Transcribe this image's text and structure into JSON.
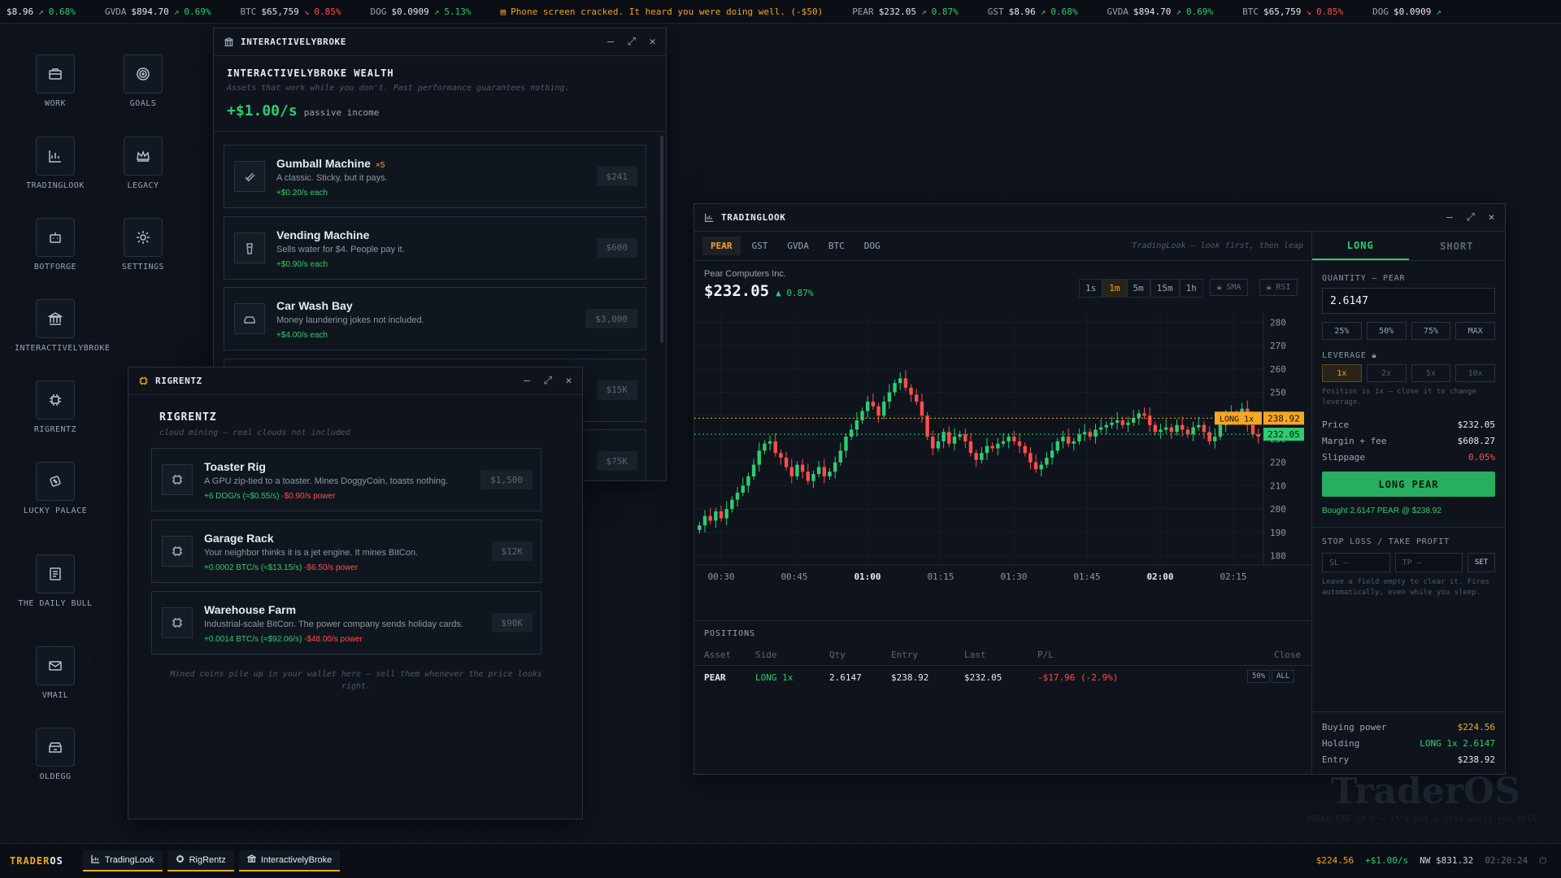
{
  "ticker": [
    {
      "sym": "",
      "price": "$8.96",
      "change": "0.68%",
      "dir": "up"
    },
    {
      "sym": "GVDA",
      "price": "$894.70",
      "change": "0.69%",
      "dir": "up"
    },
    {
      "sym": "BTC",
      "price": "$65,759",
      "change": "0.85%",
      "dir": "down"
    },
    {
      "sym": "DOG",
      "price": "$0.0909",
      "change": "5.13%",
      "dir": "up"
    },
    {
      "news": "Phone screen cracked. It heard you were doing well. (-$50)"
    },
    {
      "sym": "PEAR",
      "price": "$232.05",
      "change": "0.87%",
      "dir": "up"
    },
    {
      "sym": "GST",
      "price": "$8.96",
      "change": "0.68%",
      "dir": "up"
    },
    {
      "sym": "GVDA",
      "price": "$894.70",
      "change": "0.69%",
      "dir": "up"
    },
    {
      "sym": "BTC",
      "price": "$65,759",
      "change": "0.85%",
      "dir": "down"
    },
    {
      "sym": "DOG",
      "price": "$0.0909",
      "change": "",
      "dir": "up"
    }
  ],
  "desktop_icons": [
    {
      "label": "WORK",
      "icon": "briefcase-icon"
    },
    {
      "label": "GOALS",
      "icon": "target-icon"
    },
    {
      "label": "TRADINGLOOK",
      "icon": "chart-icon"
    },
    {
      "label": "LEGACY",
      "icon": "crown-icon"
    },
    {
      "label": "BOTFORGE",
      "icon": "robot-icon"
    },
    {
      "label": "SETTINGS",
      "icon": "gear-icon"
    },
    {
      "label": "INTERACTIVELYBROKE",
      "icon": "bank-icon"
    },
    {
      "label": "RIGRENTZ",
      "icon": "chip-icon"
    },
    {
      "label": "LUCKY PALACE",
      "icon": "dice-icon"
    },
    {
      "label": "THE DAILY BULL",
      "icon": "newspaper-icon"
    },
    {
      "label": "VMAIL",
      "icon": "mail-icon"
    },
    {
      "label": "OLDEGG",
      "icon": "store-icon"
    }
  ],
  "ib": {
    "window_title": "INTERACTIVELYBROKE",
    "title": "INTERACTIVELYBROKE WEALTH",
    "subtitle": "Assets that work while you don't. Past performance guarantees nothing.",
    "income": "+$1.00/s",
    "income_label": "passive income",
    "items": [
      {
        "name": "Gumball Machine",
        "count": "×5",
        "desc": "A classic. Sticky, but it pays.",
        "income": "+$0.20/s each",
        "price": "$241"
      },
      {
        "name": "Vending Machine",
        "count": "",
        "desc": "Sells water for $4. People pay it.",
        "income": "+$0.90/s each",
        "price": "$600"
      },
      {
        "name": "Car Wash Bay",
        "count": "",
        "desc": "Money laundering jokes not included.",
        "income": "+$4.00/s each",
        "price": "$3,000"
      },
      {
        "price": "$15K"
      },
      {
        "price": "$75K"
      }
    ]
  },
  "rr": {
    "window_title": "RIGRENTZ",
    "title": "RIGRENTZ",
    "subtitle": "cloud mining — real clouds not included",
    "items": [
      {
        "name": "Toaster Rig",
        "desc": "A GPU zip-tied to a toaster. Mines DoggyCoin, toasts nothing.",
        "yield": "+6 DOG/s (≈$0.55/s)",
        "power": "-$0.90/s power",
        "price": "$1,500"
      },
      {
        "name": "Garage Rack",
        "desc": "Your neighbor thinks it is a jet engine. It mines BitCon.",
        "yield": "+0.0002 BTC/s (≈$13.15/s)",
        "power": "-$6.50/s power",
        "price": "$12K"
      },
      {
        "name": "Warehouse Farm",
        "desc": "Industrial-scale BitCon. The power company sends holiday cards.",
        "yield": "+0.0014 BTC/s (≈$92.06/s)",
        "power": "-$48.00/s power",
        "price": "$90K"
      }
    ],
    "footer": "Mined coins pile up in your wallet here — sell them whenever the price looks right."
  },
  "tl": {
    "window_title": "TRADINGLOOK",
    "tabs": [
      "PEAR",
      "GST",
      "GVDA",
      "BTC",
      "DOG"
    ],
    "tagline": "TradingLook — look first, then leap",
    "company": "Pear Computers Inc.",
    "price": "$232.05",
    "change": "▲ 0.87%",
    "timeframes": [
      "1s",
      "1m",
      "5m",
      "15m",
      "1h"
    ],
    "indicators": [
      "SMA",
      "RSI"
    ],
    "positions_title": "POSITIONS",
    "pos_headers": [
      "Asset",
      "Side",
      "Qty",
      "Entry",
      "Last",
      "P/L",
      "Close"
    ],
    "position": {
      "asset": "PEAR",
      "side": "LONG 1x",
      "qty": "2.6147",
      "entry": "$238.92",
      "last": "$232.05",
      "pl": "-$17.96 (-2.9%)",
      "btn50": "50%",
      "btnall": "ALL"
    },
    "side_tabs": [
      "LONG",
      "SHORT"
    ],
    "qty_label": "QUANTITY — PEAR",
    "qty_value": "2.6147",
    "pct_buttons": [
      "25%",
      "50%",
      "75%",
      "MAX"
    ],
    "leverage_label": "LEVERAGE",
    "leverage": [
      "1x",
      "2x",
      "5x",
      "10x"
    ],
    "leverage_hint": "Position is 1x — close it to change leverage.",
    "price_label": "Price",
    "price_value": "$232.05",
    "margin_label": "Margin + fee",
    "margin_value": "$608.27",
    "slippage_label": "Slippage",
    "slippage_value": "0.05%",
    "action": "LONG PEAR",
    "confirm": "Bought 2.6147 PEAR @ $238.92",
    "sltp_label": "STOP LOSS / TAKE PROFIT",
    "sl_placeholder": "SL —",
    "tp_placeholder": "TP —",
    "set": "SET",
    "sltp_hint": "Leave a field empty to clear it. Fires automatically, even while you sleep.",
    "buying_power_label": "Buying power",
    "buying_power": "$224.56",
    "holding_label": "Holding",
    "holding": "LONG 1x 2.6147",
    "entry_label": "Entry",
    "entry": "$238.92",
    "entry_tag": "LONG 1x",
    "entry_tag_price": "238.92",
    "last_tag": "232.05"
  },
  "chart_data": {
    "type": "candlestick",
    "x_ticks": [
      "00:30",
      "00:45",
      "01:00",
      "01:15",
      "01:30",
      "01:45",
      "02:00",
      "02:15"
    ],
    "bold_ticks": [
      "01:00",
      "02:00"
    ],
    "y_ticks": [
      280,
      270,
      260,
      250,
      240,
      230,
      220,
      210,
      200,
      190,
      180
    ],
    "ylim": [
      176,
      284
    ],
    "entry_line": 238.92,
    "last_line": 232.05,
    "ohlc_closes": [
      193,
      197,
      195,
      199,
      196,
      200,
      204,
      207,
      210,
      214,
      219,
      225,
      228,
      229,
      224,
      222,
      218,
      214,
      219,
      216,
      212,
      215,
      218,
      214,
      216,
      220,
      225,
      231,
      234,
      238,
      242,
      246,
      244,
      240,
      246,
      250,
      254,
      256,
      252,
      249,
      246,
      240,
      231,
      226,
      229,
      233,
      228,
      231,
      232,
      229,
      224,
      221,
      224,
      227,
      226,
      228,
      229,
      231,
      229,
      227,
      224,
      220,
      217,
      219,
      222,
      225,
      229,
      231,
      228,
      229,
      232,
      233,
      231,
      234,
      235,
      236,
      237,
      238,
      236,
      237,
      239,
      241,
      240,
      236,
      233,
      234,
      235,
      233,
      236,
      234,
      232,
      235,
      236,
      233,
      229,
      231,
      236,
      240,
      241,
      239,
      243,
      236,
      232,
      231
    ]
  },
  "taskbar": {
    "brand_a": "TRADER",
    "brand_b": "OS",
    "items": [
      "TradingLook",
      "RigRentz",
      "InteractivelyBroke"
    ],
    "cash": "$224.56",
    "rate": "+$1.00/s",
    "networth": "NW $831.32",
    "clock": "02:20:24"
  },
  "watermark": {
    "title": "TraderOS",
    "sub": "BROKE.EXE v0.8 — it's not a loss until you sell"
  },
  "colors": {
    "accent": "#f5a623",
    "up": "#2ecc71",
    "down": "#ff4d4d",
    "bg": "#0e131b"
  }
}
